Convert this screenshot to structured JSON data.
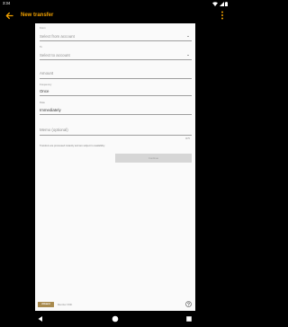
{
  "status_bar": {
    "time": "3:34"
  },
  "app_bar": {
    "title": "New transfer"
  },
  "form": {
    "from": {
      "label": "From",
      "placeholder": "Select from account"
    },
    "to": {
      "label": "To",
      "placeholder": "Select to account"
    },
    "amount": {
      "placeholder": "Amount"
    },
    "frequency": {
      "label": "Frequency",
      "value": "Once"
    },
    "date": {
      "label": "Date",
      "value": "Immediately"
    },
    "memo": {
      "placeholder": "Memo (optional)",
      "counter": "0/75"
    },
    "disclaimer": "Transfers are processed instantly and are subject to availability.",
    "continue_label": "Continue"
  },
  "footer": {
    "logo_text": "Alkami",
    "caption": "Member FDIC"
  },
  "colors": {
    "accent": "#f0a000",
    "sheet": "#fafafa",
    "background": "#000000",
    "button_disabled": "#d6d6d6"
  },
  "icons": {
    "back": "arrow-back-icon",
    "menu": "more-vert-icon",
    "help": "help-circle-icon"
  }
}
